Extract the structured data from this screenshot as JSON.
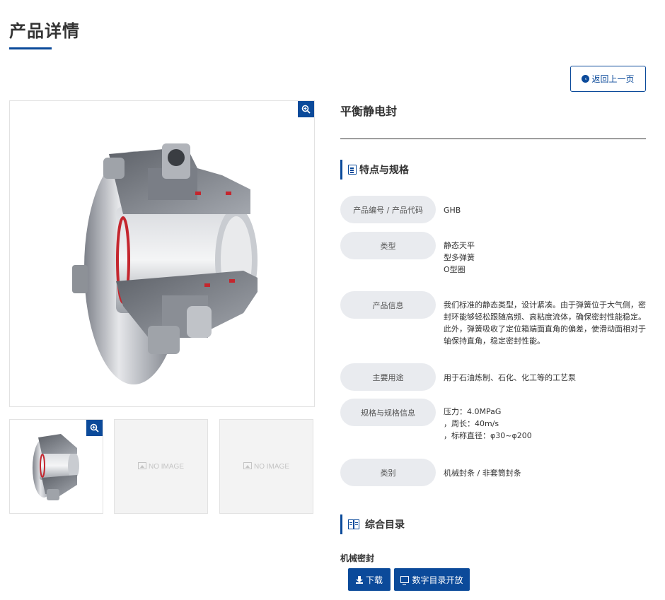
{
  "page": {
    "title": "产品详情"
  },
  "back_button": {
    "label": "返回上一页"
  },
  "gallery": {
    "no_image_text": "NO IMAGE"
  },
  "product": {
    "name": "平衡静电封"
  },
  "specs": {
    "heading": "特点与规格",
    "rows": [
      {
        "label": "产品编号 / 产品代码",
        "value": [
          "GHB"
        ]
      },
      {
        "label": "类型",
        "value": [
          "静态天平",
          "型多弹簧",
          "O型圈"
        ]
      },
      {
        "label": "产品信息",
        "value": [
          "我们标准的静态类型，设计紧凑。由于弹簧位于大气侧，密封环能够轻松跟随高频、高粘度流体，确保密封性能稳定。此外，弹簧吸收了定位箱端面直角的偏差，使滑动面相对于轴保持直角，稳定密封性能。"
        ]
      },
      {
        "label": "主要用途",
        "value": [
          "用于石油炼制、石化、化工等的工艺泵"
        ]
      },
      {
        "label": "规格与规格信息",
        "value": [
          "压力：4.0MPaG",
          "，周长：40m/s",
          "，标称直径：φ30~φ200"
        ]
      },
      {
        "label": "类别",
        "value": [
          "机械封条 / 非套筒封条"
        ]
      }
    ]
  },
  "catalog": {
    "heading": "综合目录",
    "item_title": "机械密封",
    "download_label": "下载",
    "digital_label": "数字目录开放"
  },
  "colors": {
    "brand": "#0b4a9a",
    "label_bg": "#e9ebef"
  }
}
